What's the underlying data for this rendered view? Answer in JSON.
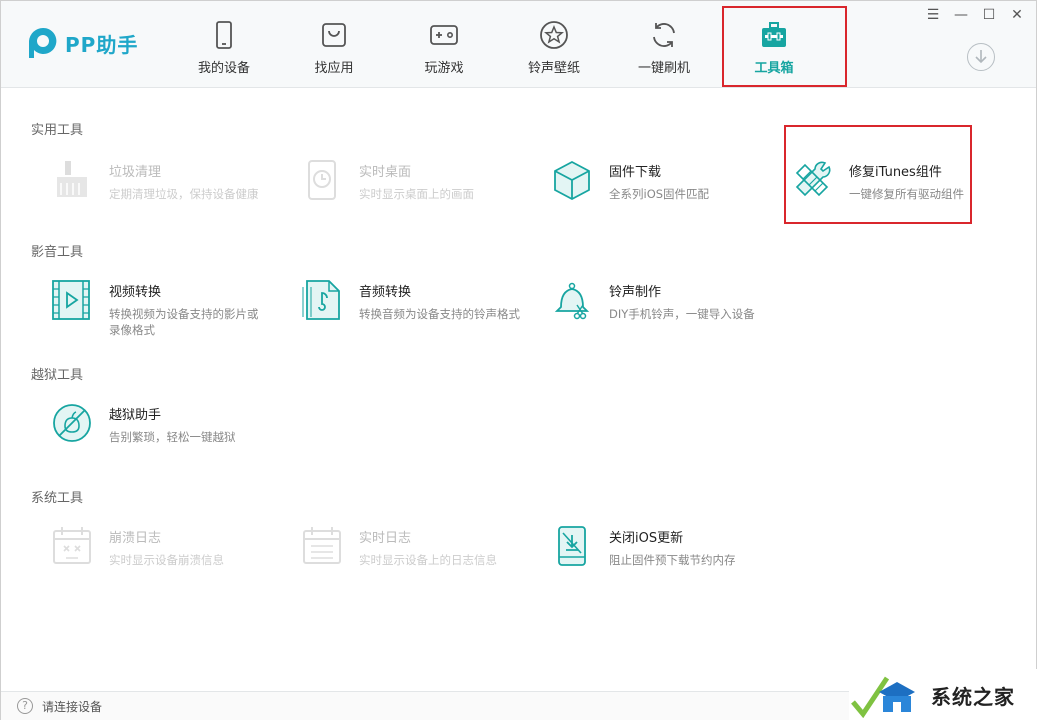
{
  "app": {
    "name": "PP助手"
  },
  "nav": {
    "items": [
      {
        "label": "我的设备",
        "icon": "phone-icon"
      },
      {
        "label": "找应用",
        "icon": "app-bag-icon"
      },
      {
        "label": "玩游戏",
        "icon": "gamepad-icon"
      },
      {
        "label": "铃声壁纸",
        "icon": "star-icon"
      },
      {
        "label": "一键刷机",
        "icon": "refresh-icon"
      },
      {
        "label": "工具箱",
        "icon": "toolbox-icon",
        "active": true
      }
    ]
  },
  "window_controls": {
    "menu": "☰",
    "minimize": "—",
    "maximize": "☐",
    "close": "✕"
  },
  "sections": {
    "practical": {
      "title": "实用工具",
      "tools": [
        {
          "name": "垃圾清理",
          "desc": "定期清理垃圾，保持设备健康",
          "disabled": true
        },
        {
          "name": "实时桌面",
          "desc": "实时显示桌面上的画面",
          "disabled": true
        },
        {
          "name": "固件下载",
          "desc": "全系列iOS固件匹配"
        },
        {
          "name": "修复iTunes组件",
          "desc": "一键修复所有驱动组件"
        }
      ]
    },
    "media": {
      "title": "影音工具",
      "tools": [
        {
          "name": "视频转换",
          "desc_line1": "转换视频为设备支持的影片或",
          "desc_line2": "录像格式"
        },
        {
          "name": "音频转换",
          "desc": "转换音频为设备支持的铃声格式"
        },
        {
          "name": "铃声制作",
          "desc": "DIY手机铃声，一键导入设备"
        }
      ]
    },
    "jailbreak": {
      "title": "越狱工具",
      "tools": [
        {
          "name": "越狱助手",
          "desc": "告别繁琐，轻松一键越狱"
        }
      ]
    },
    "system": {
      "title": "系统工具",
      "tools": [
        {
          "name": "崩溃日志",
          "desc": "实时显示设备崩溃信息",
          "disabled": true
        },
        {
          "name": "实时日志",
          "desc": "实时显示设备上的日志信息",
          "disabled": true
        },
        {
          "name": "关闭iOS更新",
          "desc": "阻止固件预下载节约内存"
        }
      ]
    }
  },
  "statusbar": {
    "text": "请连接设备"
  },
  "watermark": {
    "text": "系统之家"
  },
  "colors": {
    "accent": "#17a5a1",
    "highlight": "#d9262c",
    "logo": "#1fa7c9"
  }
}
